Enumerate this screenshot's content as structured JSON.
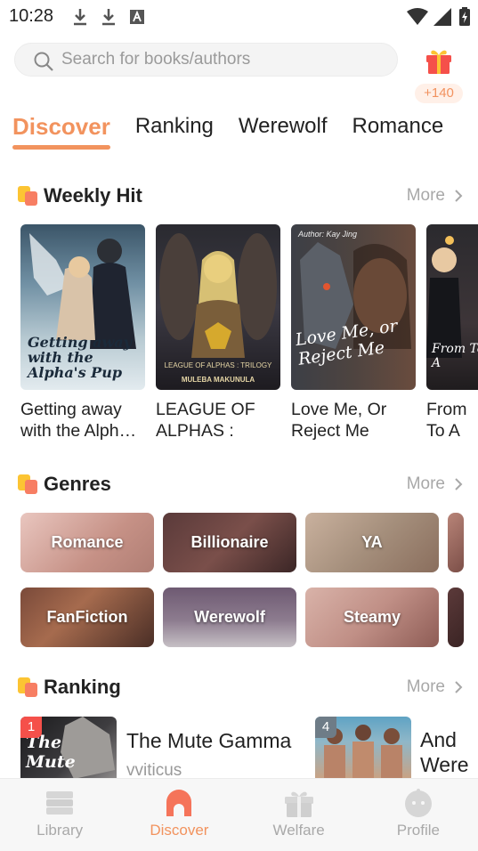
{
  "status": {
    "time": "10:28"
  },
  "search": {
    "placeholder": "Search for books/authors"
  },
  "gift": {
    "badge": "+140"
  },
  "tabs": [
    {
      "label": "Discover",
      "active": true
    },
    {
      "label": "Ranking"
    },
    {
      "label": "Werewolf"
    },
    {
      "label": "Romance"
    }
  ],
  "weekly_hit": {
    "title": "Weekly Hit",
    "more": "More",
    "books": [
      {
        "title": "Getting away with the Alph…",
        "cover_text": "Getting away with the Alpha's Pup"
      },
      {
        "title": "LEAGUE OF ALPHAS : TRI…",
        "cover_text": "LEAGUE OF ALPHAS : TRILOGY",
        "cover_author": "MULEBA MAKUNULA"
      },
      {
        "title": "Love Me, Or Reject Me",
        "cover_text": "Love Me, or Reject Me",
        "cover_author": "Author: Kay Jing"
      },
      {
        "title": "From To A",
        "cover_text": "From To A"
      }
    ]
  },
  "genres": {
    "title": "Genres",
    "more": "More",
    "items": [
      "Romance",
      "Billionaire",
      "YA",
      "FanFiction",
      "Werewolf",
      "Steamy"
    ]
  },
  "ranking": {
    "title": "Ranking",
    "more": "More",
    "items": [
      {
        "rank": "1",
        "title": "The Mute Gamma",
        "author": "vviticus",
        "cover_text": "The Mute"
      },
      {
        "rank": "4",
        "title": "And Were",
        "author": ""
      }
    ]
  },
  "nav": [
    {
      "label": "Library",
      "icon": "library-icon"
    },
    {
      "label": "Discover",
      "icon": "discover-icon",
      "active": true
    },
    {
      "label": "Welfare",
      "icon": "gift-icon"
    },
    {
      "label": "Profile",
      "icon": "profile-icon"
    }
  ],
  "colors": {
    "accent": "#f2935e",
    "muted": "#a9a9a9"
  }
}
